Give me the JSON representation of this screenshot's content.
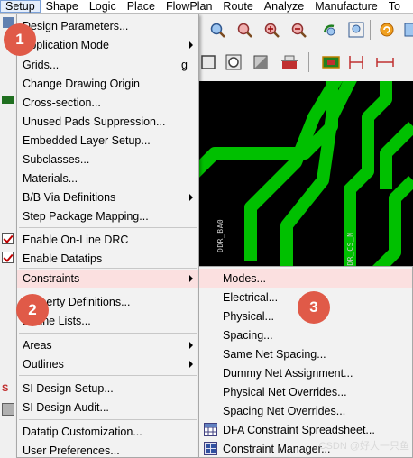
{
  "menubar": {
    "items": [
      "Setup",
      "Shape",
      "Logic",
      "Place",
      "FlowPlan",
      "Route",
      "Analyze",
      "Manufacture",
      "To"
    ],
    "active": "Setup"
  },
  "setup_menu": {
    "items": [
      {
        "label": "Design Parameters...",
        "arrow": false
      },
      {
        "label": "Application Mode",
        "arrow": true
      },
      {
        "label": "Grids...",
        "accel": "g"
      },
      {
        "label": "Change Drawing Origin"
      },
      {
        "label": "Cross-section..."
      },
      {
        "label": "Unused Pads Suppression..."
      },
      {
        "label": "Embedded Layer Setup..."
      },
      {
        "label": "Subclasses..."
      },
      {
        "label": "Materials..."
      },
      {
        "label": "B/B Via Definitions",
        "arrow": true
      },
      {
        "label": "Step Package Mapping..."
      },
      {
        "label": "Enable On-Line DRC",
        "checked": true
      },
      {
        "label": "Enable Datatips",
        "checked": true
      },
      {
        "label": "Constraints",
        "arrow": true,
        "highlighted": true
      },
      {
        "label": "Property Definitions..."
      },
      {
        "label": "Define Lists..."
      },
      {
        "label": "Areas",
        "arrow": true
      },
      {
        "label": "Outlines",
        "arrow": true
      },
      {
        "label": "SI Design Setup..."
      },
      {
        "label": "SI Design Audit..."
      },
      {
        "label": "Datatip Customization..."
      },
      {
        "label": "User Preferences..."
      }
    ]
  },
  "constraints_submenu": {
    "items": [
      {
        "label": "Modes...",
        "highlighted": true
      },
      {
        "label": "Electrical..."
      },
      {
        "label": "Physical..."
      },
      {
        "label": "Spacing..."
      },
      {
        "label": "Same Net Spacing..."
      },
      {
        "label": "Dummy Net Assignment..."
      },
      {
        "label": "Physical Net Overrides..."
      },
      {
        "label": "Spacing Net Overrides..."
      },
      {
        "label": "DFA Constraint Spreadsheet...",
        "icon": "spreadsheet-icon"
      },
      {
        "label": "Constraint Manager...",
        "icon": "constraint-manager-icon"
      }
    ]
  },
  "badges": [
    "1",
    "2",
    "3"
  ],
  "canvas_labels": [
    "DDR_BA0",
    "DDR_CS_N"
  ],
  "watermark": "CSDN @好大一只鱼",
  "colors": {
    "trace": "#00c000",
    "badge": "#e05a48",
    "highlight": "#fbe0e0"
  }
}
